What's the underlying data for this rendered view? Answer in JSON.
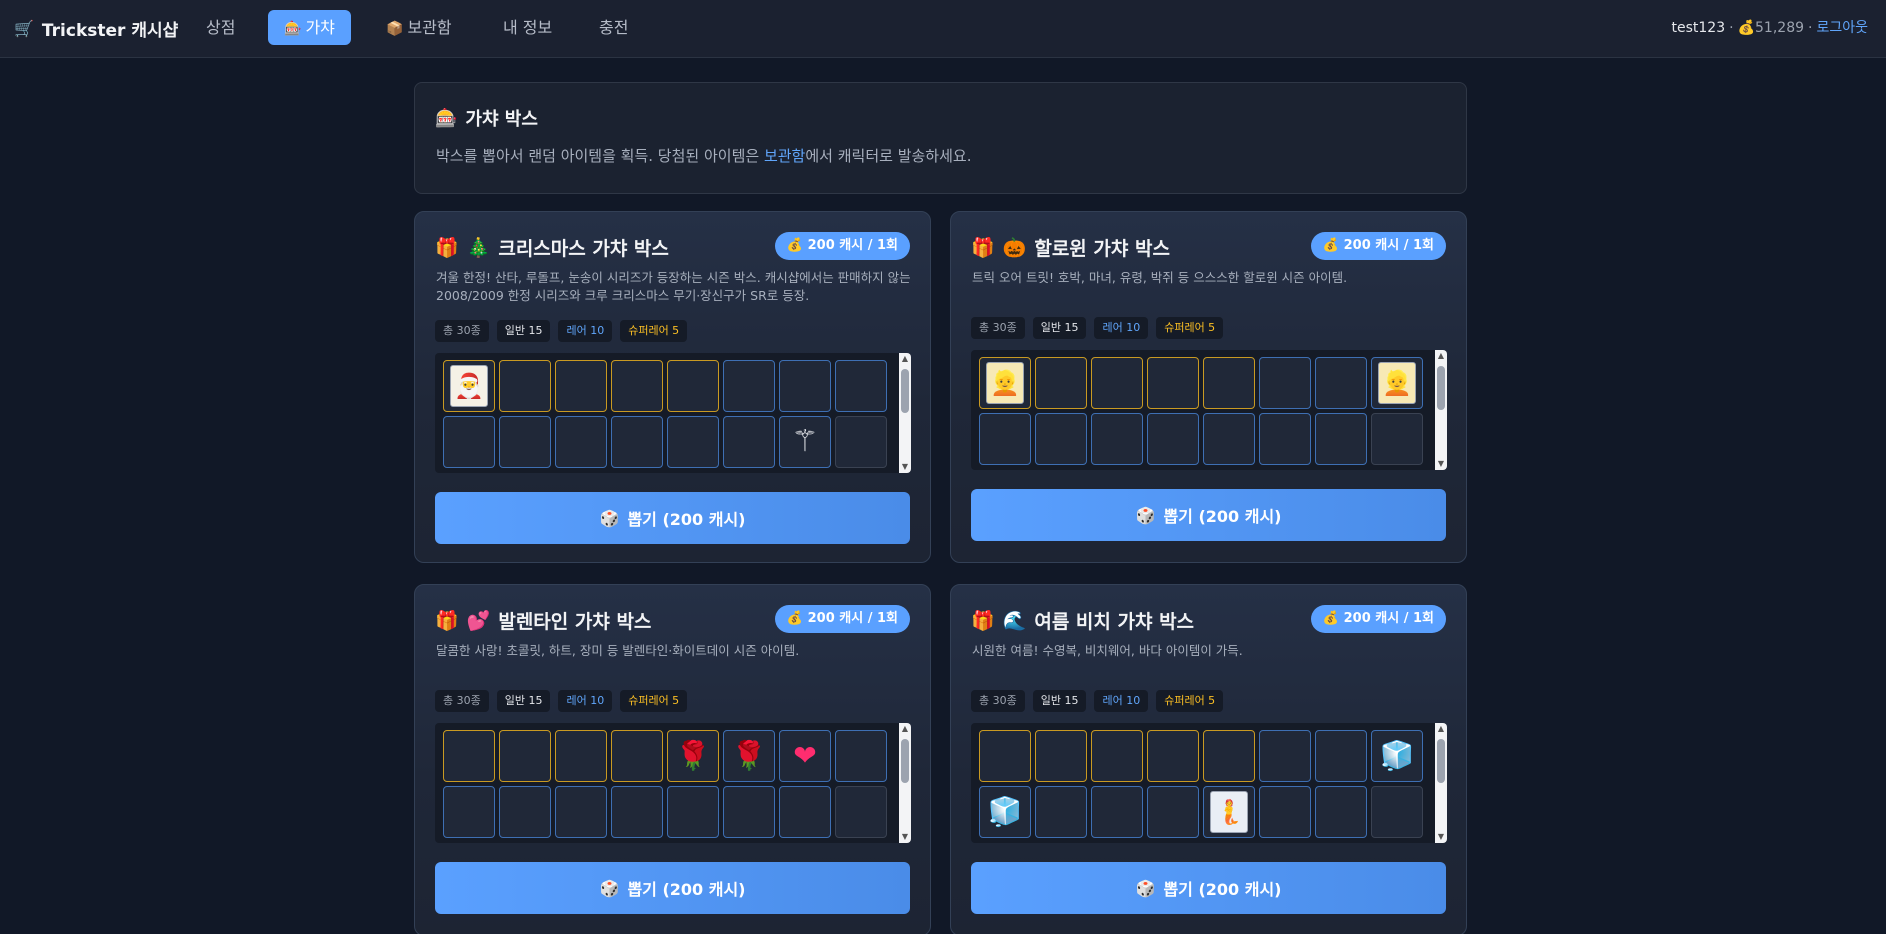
{
  "nav": {
    "brand_icon": "🛒",
    "brand": "Trickster 캐시샵",
    "items": [
      {
        "label": "상점",
        "icon": ""
      },
      {
        "label": "가챠",
        "icon": "🎰"
      },
      {
        "label": "보관함",
        "icon": "📦"
      },
      {
        "label": "내 정보",
        "icon": ""
      },
      {
        "label": "충전",
        "icon": ""
      }
    ],
    "active": "가챠"
  },
  "user": {
    "name": "test123",
    "cash_icon": "💰",
    "cash": "51,289",
    "logout": "로그아웃"
  },
  "intro": {
    "icon": "🎰",
    "title": "가챠 박스",
    "desc_before": "박스를 뽑아서 랜덤 아이템을 획득. 당첨된 아이템은 ",
    "desc_link": "보관함",
    "desc_after": "에서 캐릭터로 발송하세요."
  },
  "boxes": [
    {
      "gift_icon": "🎁",
      "theme_icon": "🎄",
      "title": "크리스마스 가챠 박스",
      "price": "💰 200 캐시 / 1회",
      "desc": "겨울 한정! 산타, 루돌프, 눈송이 시리즈가 등장하는 시즌 박스. 캐시샵에서는 판매하지 않는 2008/2009 한정 시리즈와 크루 크리스마스 무기·장신구가 SR로 등장.",
      "stats": {
        "total": "총 30종",
        "normal": "일반 15",
        "rare": "레어 10",
        "srare": "슈퍼레어 5"
      },
      "draw": "뽑기 (200 캐시)",
      "draw_icon": "🎲"
    },
    {
      "gift_icon": "🎁",
      "theme_icon": "🎃",
      "title": "할로윈 가챠 박스",
      "price": "💰 200 캐시 / 1회",
      "desc": "트릭 오어 트릿! 호박, 마녀, 유령, 박쥐 등 으스스한 할로윈 시즌 아이템.",
      "stats": {
        "total": "총 30종",
        "normal": "일반 15",
        "rare": "레어 10",
        "srare": "슈퍼레어 5"
      },
      "draw": "뽑기 (200 캐시)",
      "draw_icon": "🎲"
    },
    {
      "gift_icon": "🎁",
      "theme_icon": "💕",
      "title": "발렌타인 가챠 박스",
      "price": "💰 200 캐시 / 1회",
      "desc": "달콤한 사랑! 초콜릿, 하트, 장미 등 발렌타인·화이트데이 시즌 아이템.",
      "stats": {
        "total": "총 30종",
        "normal": "일반 15",
        "rare": "레어 10",
        "srare": "슈퍼레어 5"
      },
      "draw": "뽑기 (200 캐시)",
      "draw_icon": "🎲"
    },
    {
      "gift_icon": "🎁",
      "theme_icon": "🌊",
      "title": "여름 비치 가챠 박스",
      "price": "💰 200 캐시 / 1회",
      "desc": "시원한 여름! 수영복, 비치웨어, 바다 아이템이 가득.",
      "stats": {
        "total": "총 30종",
        "normal": "일반 15",
        "rare": "레어 10",
        "srare": "슈퍼레어 5"
      },
      "draw": "뽑기 (200 캐시)",
      "draw_icon": "🎲"
    }
  ],
  "colors": {
    "accent": "#5aa0ff",
    "background": "#111827",
    "super_rare_border": "#c99a22",
    "rare_border": "#3e6fb3"
  }
}
